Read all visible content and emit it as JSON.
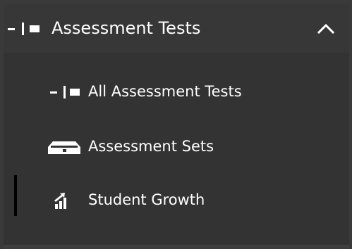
{
  "section": {
    "title": "Assessment Tests",
    "icon": "dash-pipe-square-icon",
    "toggle_icon": "chevron-up-icon"
  },
  "nav": {
    "items": [
      {
        "label": "All Assessment Tests",
        "icon": "dash-pipe-square-icon",
        "active": false
      },
      {
        "label": "Assessment Sets",
        "icon": "tray-icon",
        "active": false
      },
      {
        "label": "Student Growth",
        "icon": "growth-bars-icon",
        "active": true
      }
    ]
  },
  "colors": {
    "panel_background": "#333333",
    "text": "#ffffff",
    "active_indicator": "#000000"
  }
}
